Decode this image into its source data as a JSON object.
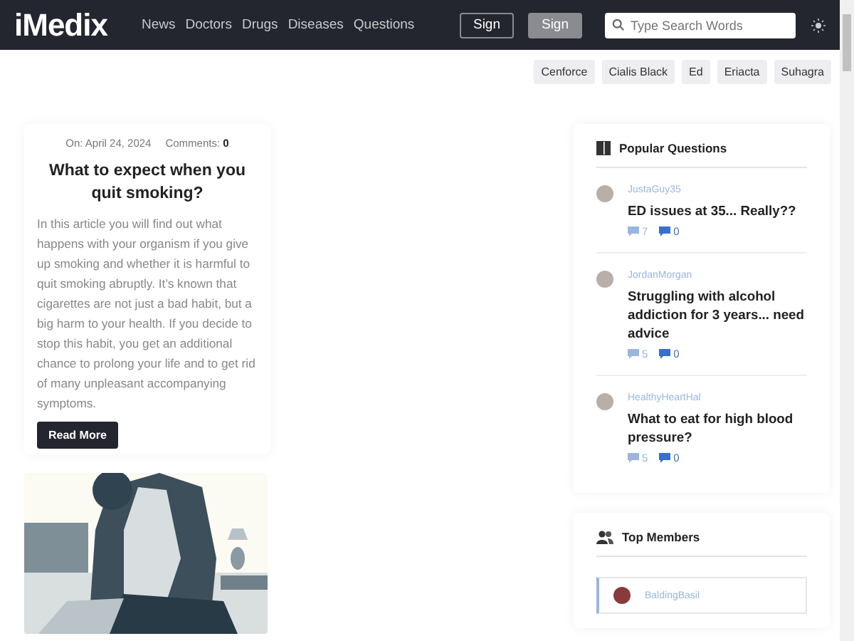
{
  "header": {
    "logo": "iMedix",
    "nav": [
      "News",
      "Doctors",
      "Drugs",
      "Diseases",
      "Questions"
    ],
    "buttons": [
      {
        "label": "Sign",
        "kind": "outline"
      },
      {
        "label": "Sign",
        "kind": "filled"
      }
    ],
    "search": {
      "placeholder": "Type Search Words"
    }
  },
  "tags": [
    "Cenforce",
    "Cialis Black",
    "Ed",
    "Eriacta",
    "Suhagra"
  ],
  "article": {
    "date": "On: April 24, 2024",
    "comments_label": "Comments:",
    "comments": "0",
    "title": "What to expect when you quit smoking?",
    "excerpt": "In this article you will find out what happens with your organism if you give up smoking and whether it is harmful to quit smoking abruptly. It’s known that cigarettes are not just a bad habit, but a big harm to your health. If you decide to stop this habit, you get an additional chance to prolong your life and to get rid of many unpleasant accompanying symptoms.",
    "button": "Read More"
  },
  "popular_questions": {
    "title": "Popular Questions",
    "items": [
      {
        "user": "JustaGuy35",
        "question": "ED issues at 35... Really??",
        "answers": "7",
        "comments": "0"
      },
      {
        "user": "JordanMorgan",
        "question": "Struggling with alcohol addiction for 3 years... need advice",
        "answers": "5",
        "comments": "0"
      },
      {
        "user": "HealthyHeartHal",
        "question": "What to eat for high blood pressure?",
        "answers": "5",
        "comments": "0"
      }
    ]
  },
  "top_members": {
    "title": "Top Members",
    "items": [
      {
        "user": "BaldingBasil"
      }
    ]
  }
}
